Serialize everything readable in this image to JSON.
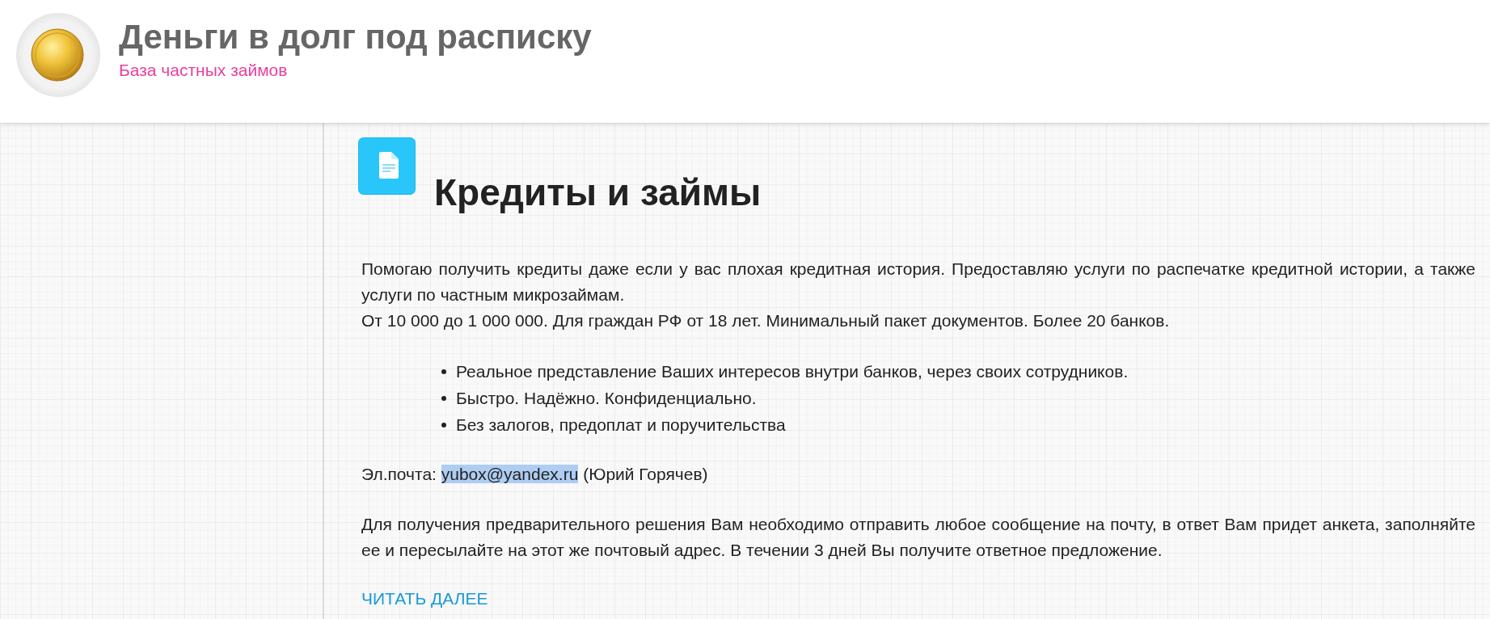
{
  "header": {
    "site_title": "Деньги в долг под расписку",
    "tagline": "База частных займов"
  },
  "post": {
    "title": "Кредиты и займы",
    "intro": [
      "Помогаю получить кредиты даже если у вас плохая кредитная история. Предоставляю услуги по распечатке кредитной истории, а также услуги по частным микрозаймам.",
      "От 10 000 до 1 000 000. Для граждан РФ от 18 лет. Минимальный пакет документов. Более 20 банков."
    ],
    "benefits": [
      "Реальное представление Ваших интересов внутри банков, через своих сотрудников.",
      "Быстро. Надёжно. Конфиденциально.",
      "Без залогов, предоплат и поручительства"
    ],
    "contact": {
      "label": "Эл.почта:",
      "email": "yubox@yandex.ru",
      "email_selected": true,
      "name": "(Юрий Горячев)"
    },
    "note": "Для получения предварительного решения Вам необходимо отправить любое сообщение на почту, в ответ Вам придет анкета, заполняйте ее и пересылайте на этот же почтовый адрес. В течении 3 дней Вы получите ответное предложение.",
    "read_more": "ЧИТАТЬ ДАЛЕЕ"
  }
}
